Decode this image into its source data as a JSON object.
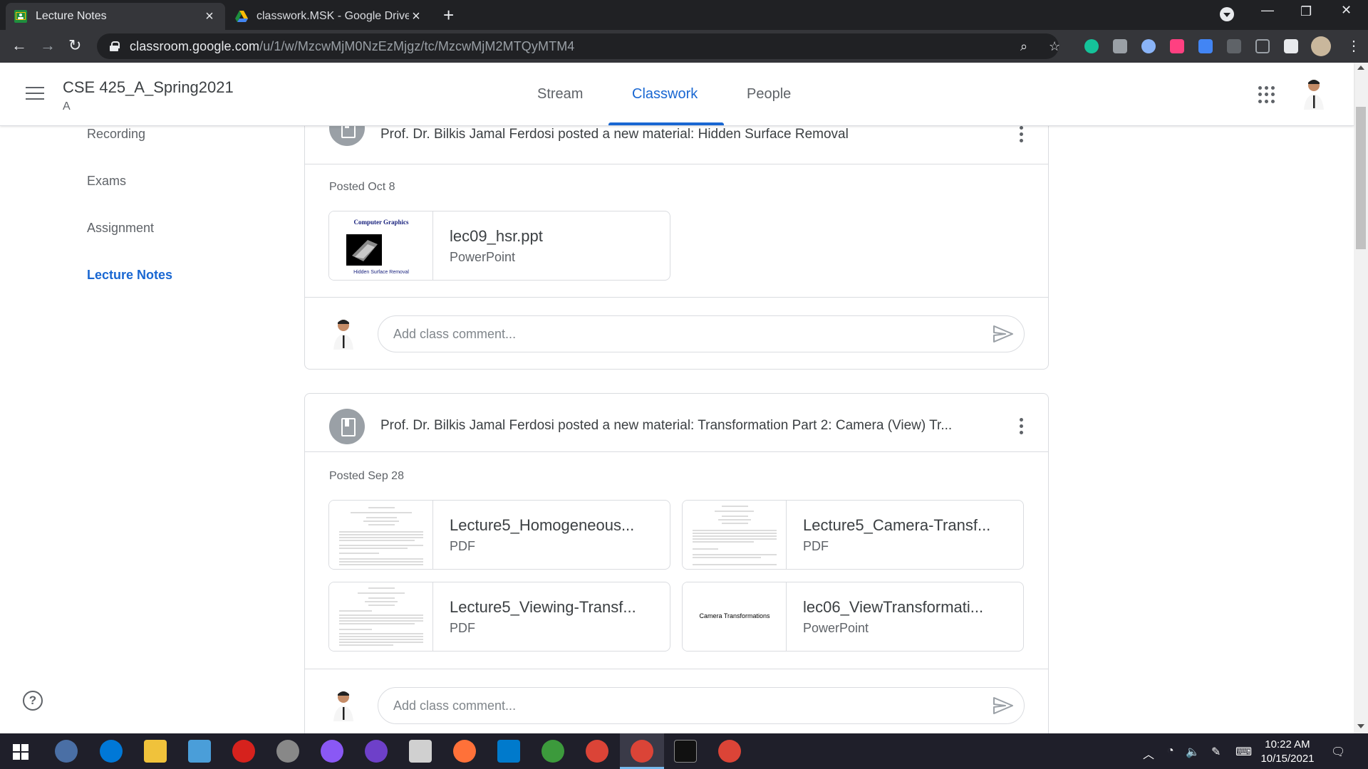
{
  "browser": {
    "tabs": [
      {
        "title": "Lecture Notes",
        "active": true
      },
      {
        "title": "classwork.MSK - Google Drive",
        "active": false
      }
    ],
    "url_host": "classroom.google.com",
    "url_path": "/u/1/w/MzcwMjM0NzEzMjgz/tc/MzcwMjM2MTQyMTM4"
  },
  "header": {
    "course_title": "CSE 425_A_Spring2021",
    "section": "A",
    "tabs": [
      "Stream",
      "Classwork",
      "People"
    ],
    "active_tab": "Classwork"
  },
  "sidebar": {
    "items": [
      {
        "label": "Recording"
      },
      {
        "label": "Exams"
      },
      {
        "label": "Assignment"
      },
      {
        "label": "Lecture Notes",
        "active": true
      }
    ]
  },
  "posts": [
    {
      "title": "Prof. Dr. Bilkis Jamal Ferdosi posted a new material: Hidden Surface Removal",
      "posted": "Posted Oct 8",
      "attachments": [
        {
          "name": "lec09_hsr.ppt",
          "type": "PowerPoint",
          "thumb_title": "Computer Graphics",
          "thumb_caption": "Hidden Surface Removal"
        }
      ],
      "comment_placeholder": "Add class comment..."
    },
    {
      "title": "Prof. Dr. Bilkis Jamal Ferdosi posted a new material: Transformation Part 2: Camera (View) Tr...",
      "posted": "Posted Sep 28",
      "attachments": [
        {
          "name": "Lecture5_Homogeneous...",
          "type": "PDF"
        },
        {
          "name": "Lecture5_Camera-Transf...",
          "type": "PDF"
        },
        {
          "name": "Lecture5_Viewing-Transf...",
          "type": "PDF"
        },
        {
          "name": "lec06_ViewTransformati...",
          "type": "PowerPoint",
          "thumb_title": "Camera Transformations"
        }
      ],
      "comment_placeholder": "Add class comment..."
    }
  ],
  "taskbar": {
    "time": "10:22 AM",
    "date": "10/15/2021"
  },
  "colors": {
    "accent": "#1967d2",
    "chrome_dark": "#202124",
    "chrome_toolbar": "#35363a",
    "taskbar": "#1f1f2a"
  }
}
